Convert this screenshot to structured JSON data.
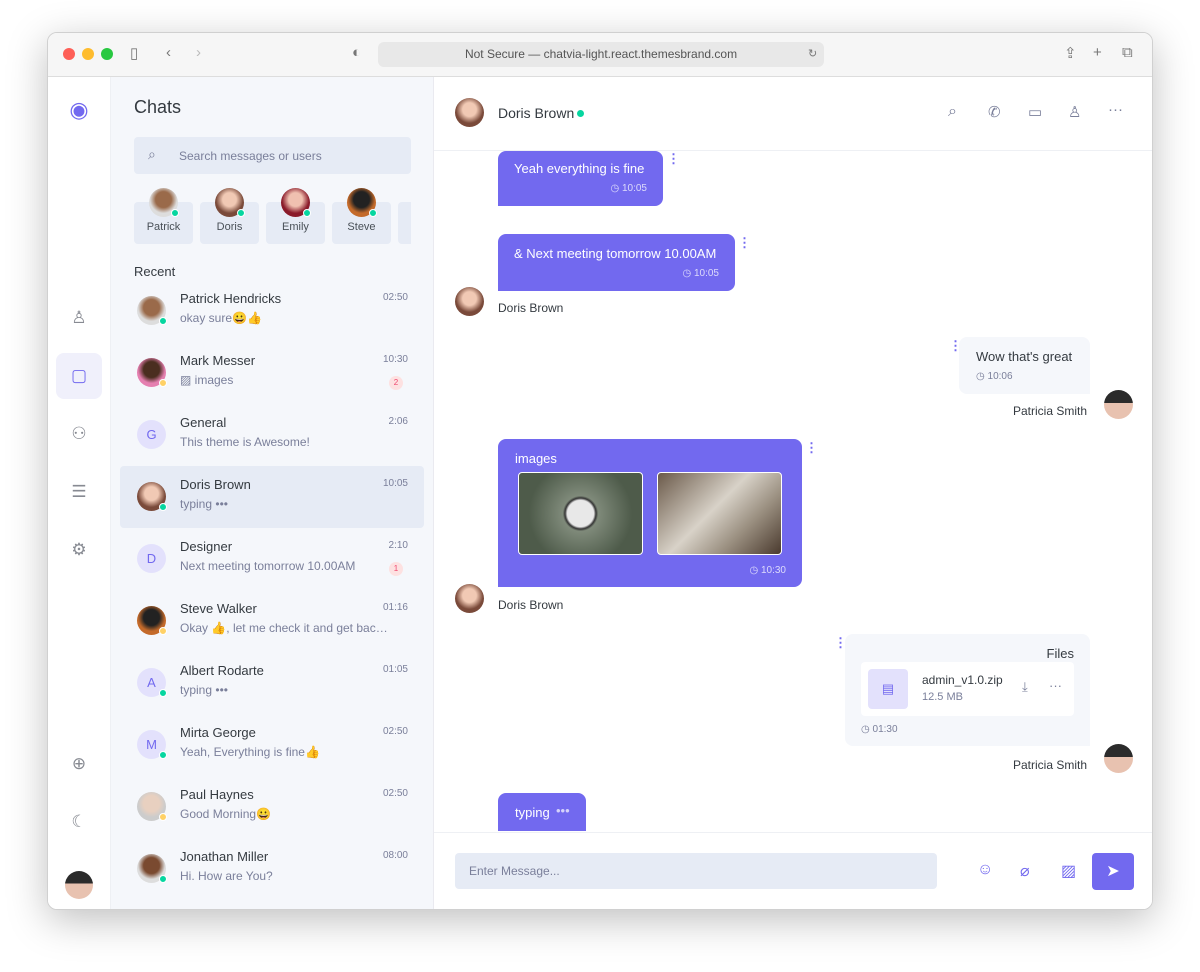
{
  "browser": {
    "url": "Not Secure — chatvia-light.react.themesbrand.com"
  },
  "colors": {
    "accent": "#7269ef",
    "online": "#06d6a0",
    "away": "#ffd166",
    "badge": "#ef476f",
    "list_bg": "#f5f7fb"
  },
  "sidebar": {
    "items": [
      "logo-icon",
      "profile-icon",
      "chats-icon",
      "groups-icon",
      "contacts-icon",
      "settings-icon",
      "language-icon",
      "dark-mode-icon",
      "user-avatar"
    ]
  },
  "chats": {
    "title": "Chats",
    "search_placeholder": "Search messages or users",
    "online": [
      {
        "name": "Patrick"
      },
      {
        "name": "Doris"
      },
      {
        "name": "Emily"
      },
      {
        "name": "Steve"
      }
    ],
    "recent_label": "Recent",
    "items": [
      {
        "name": "Patrick Hendricks",
        "message": "okay sure😀👍",
        "time": "02:50",
        "status": "online"
      },
      {
        "name": "Mark Messer",
        "message": "images",
        "time": "10:30",
        "badge": "2",
        "status": "away"
      },
      {
        "name": "General",
        "initial": "G",
        "message": "This theme is Awesome!",
        "time": "2:06"
      },
      {
        "name": "Doris Brown",
        "message": "typing",
        "time": "10:05",
        "status": "online",
        "active": true
      },
      {
        "name": "Designer",
        "initial": "D",
        "message": "Next meeting tomorrow 10.00AM",
        "time": "2:10",
        "badge": "1"
      },
      {
        "name": "Steve Walker",
        "message": "Okay 👍, let me check it and get back to you soon",
        "time": "01:16",
        "status": "away"
      },
      {
        "name": "Albert Rodarte",
        "initial": "A",
        "message": "typing",
        "time": "01:05",
        "status": "online"
      },
      {
        "name": "Mirta George",
        "initial": "M",
        "message": "Yeah, Everything is fine👍",
        "time": "02:50",
        "status": "online"
      },
      {
        "name": "Paul Haynes",
        "message": "Good Morning😀",
        "time": "02:50",
        "status": "away"
      },
      {
        "name": "Jonathan Miller",
        "message": "Hi. How are You?",
        "time": "08:00",
        "status": "online"
      }
    ]
  },
  "conversation": {
    "name": "Doris Brown",
    "messages": [
      {
        "text": "Yeah everything is fine",
        "time": "10:05"
      },
      {
        "text": "& Next meeting tomorrow 10.00AM",
        "time": "10:05",
        "sender": "Doris Brown"
      },
      {
        "text": "Wow that's great",
        "time": "10:06",
        "sender": "Patricia Smith"
      },
      {
        "text": "images",
        "time": "10:30",
        "sender": "Doris Brown"
      },
      {
        "title": "Files",
        "file_name": "admin_v1.0.zip",
        "file_size": "12.5 MB",
        "time": "01:30",
        "sender": "Patricia Smith"
      },
      {
        "text": "typing"
      }
    ],
    "input_placeholder": "Enter Message..."
  }
}
